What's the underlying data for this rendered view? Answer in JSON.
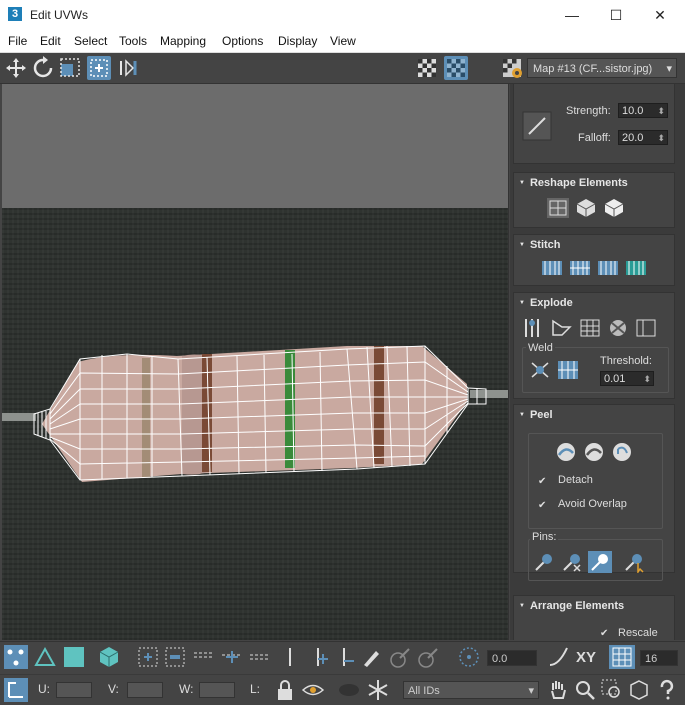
{
  "window": {
    "title": "Edit UVWs",
    "app_icon": "3",
    "minimize": "—",
    "maximize": "☐",
    "close": "✕"
  },
  "menu": [
    "File",
    "Edit",
    "Select",
    "Tools",
    "Mapping",
    "Options",
    "Display",
    "View"
  ],
  "toolbar": {
    "uv_label": "U V",
    "map_dropdown": "Map #13 (CF...sistor.jpg)"
  },
  "panel": {
    "brush": {
      "strength_label": "Strength:",
      "strength_value": "10.0",
      "falloff_label": "Falloff:",
      "falloff_value": "20.0"
    },
    "reshape": {
      "title": "Reshape Elements"
    },
    "stitch": {
      "title": "Stitch"
    },
    "explode": {
      "title": "Explode",
      "weld_label": "Weld",
      "threshold_label": "Threshold:",
      "threshold_value": "0.01"
    },
    "peel": {
      "title": "Peel",
      "detach_label": "Detach",
      "detach_checked": true,
      "avoid_overlap_label": "Avoid Overlap",
      "avoid_overlap_checked": true,
      "pins_label": "Pins:"
    },
    "arrange": {
      "title": "Arrange Elements",
      "rescale_label": "Rescale",
      "rescale_checked": true
    }
  },
  "bottom": {
    "angle_value": "0.0",
    "xy_label": "XY",
    "grid_value": "16",
    "u_label": "U:",
    "v_label": "V:",
    "w_label": "W:",
    "l_label": "L:",
    "ids_value": "All IDs"
  },
  "colors": {
    "accent": "#5d8fb7",
    "panel_bg": "#444444",
    "viewport_top": "#6c6c6c",
    "uv_wire": "#ffffff"
  }
}
